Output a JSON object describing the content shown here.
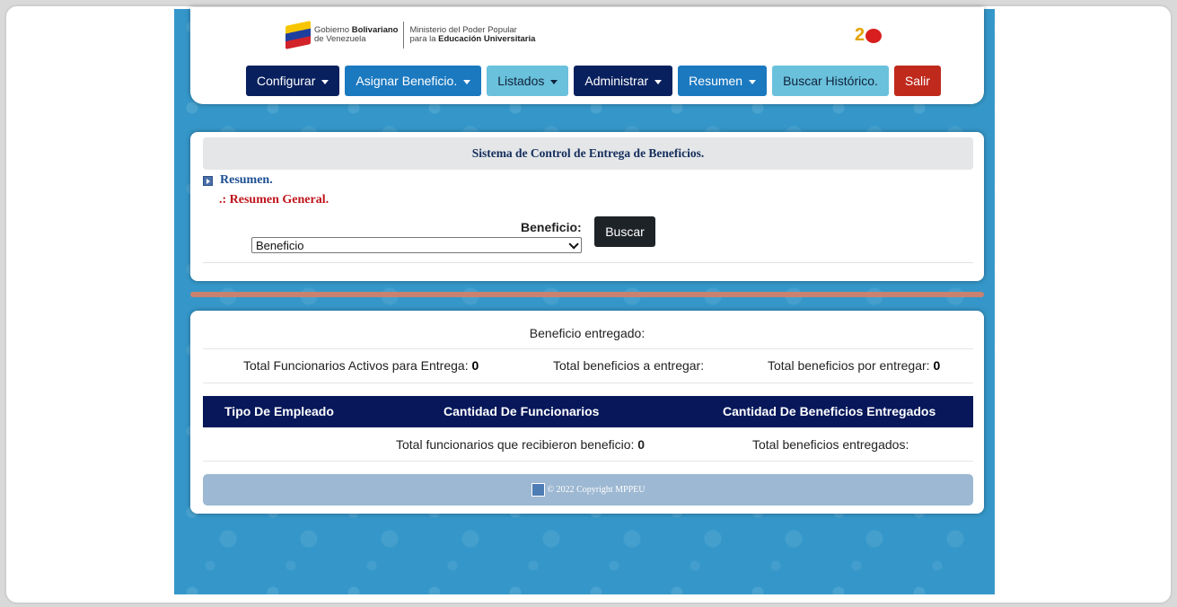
{
  "header": {
    "gov_line1_prefix": "Gobierno ",
    "gov_line1_bold": "Bolivariano",
    "gov_line2": "de Venezuela",
    "ministry_line1": "Ministerio del Poder Popular",
    "ministry_line2_prefix": "para la ",
    "ministry_line2_bold": "Educación Universitaria"
  },
  "nav": {
    "configurar": "Configurar",
    "asignar": "Asignar Beneficio.",
    "listados": "Listados",
    "administrar": "Administrar",
    "resumen": "Resumen",
    "buscar_historico": "Buscar Histórico.",
    "salir": "Salir"
  },
  "form": {
    "title": "Sistema de Control de Entrega de Beneficios.",
    "crumb_1": "Resumen.",
    "crumb_2": ".: Resumen General.",
    "beneficio_label": "Beneficio:",
    "beneficio_selected": "Beneficio",
    "buscar_button": "Buscar"
  },
  "results": {
    "title": "Beneficio entregado:",
    "stat_activos_label": "Total Funcionarios Activos para Entrega: ",
    "stat_activos_value": "0",
    "stat_a_entregar_label": "Total beneficios a entregar:",
    "stat_por_entregar_label": "Total beneficios por entregar: ",
    "stat_por_entregar_value": "0",
    "columns": [
      "Tipo De Empleado",
      "Cantidad De Funcionarios",
      "Cantidad De Beneficios Entregados"
    ],
    "total_recibieron_label": "Total funcionarios que recibieron beneficio: ",
    "total_recibieron_value": "0",
    "total_entregados_label": "Total beneficios entregados:"
  },
  "footer": {
    "copyright": "© 2022 Copyright MPPEU"
  },
  "colors": {
    "nav_dark": "#08205e",
    "nav_mid": "#1b79c0",
    "nav_light": "#6ac1dc",
    "nav_red": "#bf2a1c",
    "table_header": "#07175a",
    "background_blue": "#3597c9"
  }
}
